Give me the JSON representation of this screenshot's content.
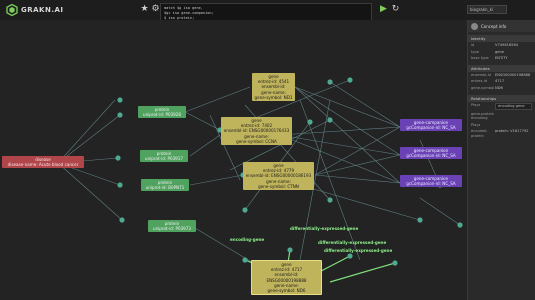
{
  "app": {
    "brand": "GRAKN.AI"
  },
  "toolbar": {
    "star_icon": "star-icon",
    "gear_icon": "gear-icon",
    "run_icon": "play-icon",
    "refresh_icon": "refresh-icon"
  },
  "query": {
    "lines": [
      {
        "text": "match $g isa gene,"
      },
      {
        "text": "  $gc isa gene-companion;"
      },
      {
        "text": "  $ isa protein;"
      },
      {
        "text": "  $d isa disease, has disease-name \"Acute blood cancer\";"
      },
      {
        "text": "  ($d, $g) isa differentially-expressed-finding;"
      },
      {
        "text": "  ($, $g) isa gene-context-encoding; ($d, $g) isa protein-disease-association; get;"
      }
    ]
  },
  "keyspace": {
    "value": "biograkn_ki"
  },
  "panel": {
    "title": "Concept info",
    "sections": [
      {
        "title": "Identity",
        "rows": [
          {
            "k": "id",
            "v": "V749816584"
          },
          {
            "k": "type",
            "v": "gene"
          },
          {
            "k": "base type",
            "v": "ENTITY"
          }
        ]
      },
      {
        "title": "Attributes",
        "rows": [
          {
            "k": "ensembl-id",
            "v": "ENSG00000198888"
          },
          {
            "k": "entrez-id",
            "v": "4717"
          },
          {
            "k": "gene-symbol",
            "v": "ND6"
          }
        ]
      },
      {
        "title": "Relationships",
        "rows": [
          {
            "k": "Plays",
            "v": "encoding-gene"
          },
          {
            "k": "gene-protein encoding",
            "v": ""
          },
          {
            "k": "Plays",
            "v": ""
          },
          {
            "k": "encoded-protein",
            "v": "protein: V1617792"
          }
        ]
      }
    ],
    "select": "encoding gene"
  },
  "nodes": [
    {
      "id": "disease",
      "type": "disease",
      "lines": [
        "disease",
        "disease-name: Acute blood cancer"
      ]
    },
    {
      "id": "p1",
      "type": "protein",
      "lines": [
        "protein",
        "uniprot-id: P03928"
      ]
    },
    {
      "id": "p2",
      "type": "protein",
      "lines": [
        "protein",
        "uniprot-id: P03917"
      ]
    },
    {
      "id": "p3",
      "type": "protein",
      "lines": [
        "protein",
        "uniprot-id: B0PN71"
      ]
    },
    {
      "id": "p4",
      "type": "protein",
      "lines": [
        "protein",
        "uniprot-id: P03973"
      ]
    },
    {
      "id": "g1",
      "type": "gene",
      "lines": [
        "gene",
        "entrez-id: 4541",
        "ensembl-id:",
        "gene-name:",
        "gene-symbol: ND1"
      ]
    },
    {
      "id": "g2",
      "type": "gene",
      "lines": [
        "gene",
        "entrez-id: 7402",
        "ensembl-id: ENSG00000176433",
        "gene-name:",
        "gene-symbol: CCNA"
      ]
    },
    {
      "id": "g3",
      "type": "gene",
      "lines": [
        "gene",
        "entrez-id: 4779",
        "ensembl-id: ENSG00000186193",
        "gene-name:",
        "gene-symbol: CTNN"
      ]
    },
    {
      "id": "g4",
      "type": "gene",
      "lines": [
        "gene",
        "entrez-id: 4717",
        "ensembl-id: ENSG00000198888",
        "gene-name:",
        "gene-symbol: ND6"
      ]
    },
    {
      "id": "gc1",
      "type": "gc",
      "lines": [
        "gene-companion",
        "gcCompanion-id: NC_SA"
      ]
    },
    {
      "id": "gc2",
      "type": "gc",
      "lines": [
        "gene-companion",
        "gcCompanion-id: NC_SA"
      ]
    },
    {
      "id": "gc3",
      "type": "gc",
      "lines": [
        "gene-companion",
        "gcCompanion-id: NC_SA"
      ]
    }
  ],
  "edge_labels": [
    "encoding-gene",
    "differentially-expressed-gene",
    "differentially-expressed-gene",
    "differentially-expressed-gene"
  ]
}
